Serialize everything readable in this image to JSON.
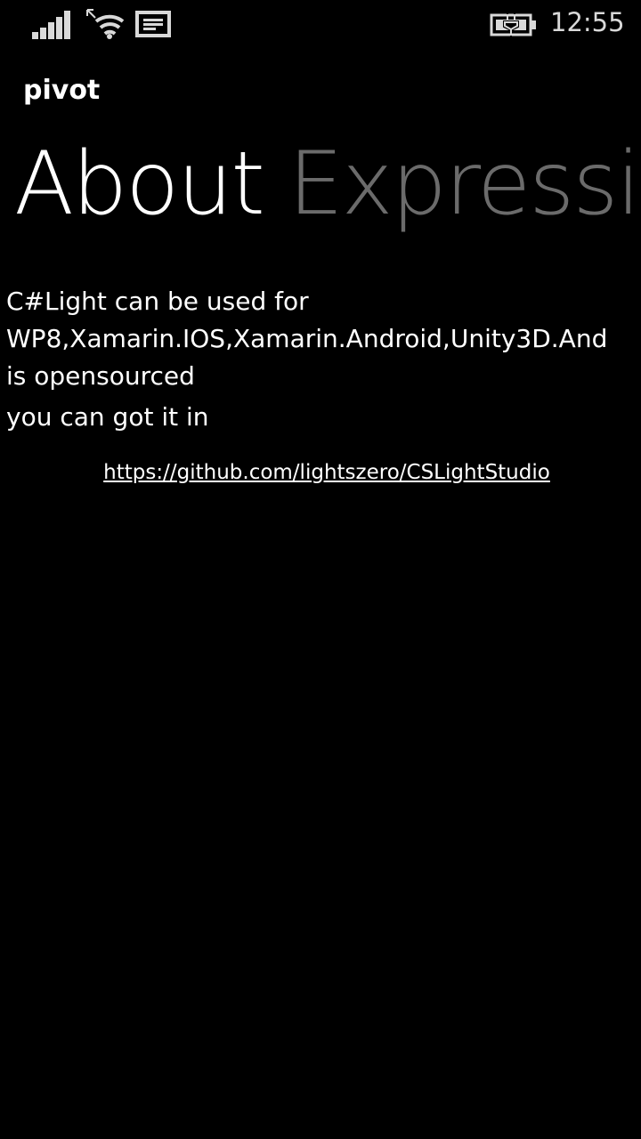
{
  "status_bar": {
    "time": "12:55",
    "icons": {
      "signal": "signal-strength-icon",
      "wifi": "wifi-icon",
      "message": "message-icon",
      "battery": "battery-charging-icon"
    }
  },
  "pivot": {
    "title": "pivot",
    "headers": [
      {
        "label": "About",
        "active": true
      },
      {
        "label": "Expressi",
        "active": false
      }
    ]
  },
  "content": {
    "paragraph_1": "C#Light can be used for WP8,Xamarin.IOS,Xamarin.Android,Unity3D.And is opensourced",
    "paragraph_2": "you can got it in",
    "link": "https://github.com/lightszero/CSLightStudio"
  },
  "colors": {
    "background": "#000000",
    "text": "#ffffff",
    "inactive_header": "#6b6b6b"
  }
}
